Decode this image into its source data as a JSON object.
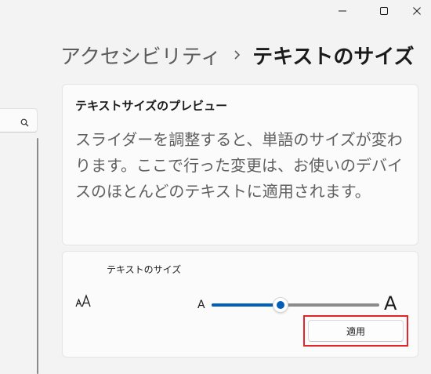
{
  "window": {
    "controls": [
      {
        "name": "minimize-icon"
      },
      {
        "name": "maximize-icon"
      },
      {
        "name": "close-icon"
      }
    ]
  },
  "nav": {
    "search_icon": "search-icon"
  },
  "breadcrumb": {
    "parent": "アクセシビリティ",
    "separator_icon": "chevron-right-icon",
    "current": "テキストのサイズ"
  },
  "preview": {
    "title": "テキストサイズのプレビュー",
    "text": "スライダーを調整すると、単語のサイズが変わります。ここで行った変更は、お使いのデバイスのほとんどのテキストに適用されます。"
  },
  "text_size": {
    "label": "テキストのサイズ",
    "icon": "text-size-icon",
    "slider": {
      "min_label": "A",
      "max_label": "A",
      "value_fraction": 0.41
    },
    "apply_label": "適用",
    "highlight_color": "#e3242b"
  },
  "colors": {
    "accent": "#005fb8",
    "background": "#f3f3f3",
    "card": "#fbfbfb"
  }
}
